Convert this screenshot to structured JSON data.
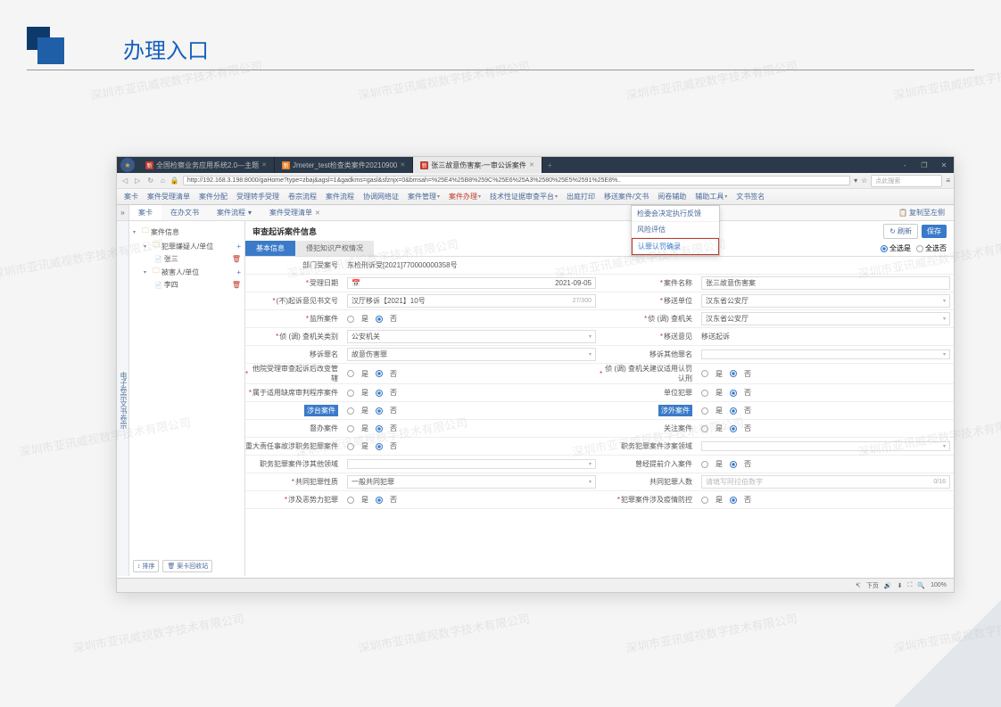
{
  "watermark_text": "深圳市亚讯威视数字技术有限公司",
  "slide": {
    "title": "办理入口"
  },
  "browser": {
    "tabs": [
      {
        "label": "全国检察业务应用系统2.0—主题",
        "badge": "新"
      },
      {
        "label": "Jmeter_test检查类案件20210900",
        "badge": "新"
      },
      {
        "label": "张三故意伤害案-一审公诉案件",
        "badge": "新",
        "active": true
      }
    ],
    "url": "http://192.168.3.198:8000/gaHome?type=zbaj&agsl=1&gadkms=gasl&sfznjx=0&bmsah=%25E4%25B8%259C%25E6%25A3%2580%25E5%2591%25E8%..",
    "search_placeholder": "点此搜索"
  },
  "menu": {
    "items": [
      "案卡",
      "案件受理清单",
      "案件分配",
      "受理转手受理",
      "卷宗流程",
      "案件流程",
      "协调网络证",
      "案件管理",
      "案件办理",
      "技术性证据审查平台",
      "出庭打印",
      "移送案件/文书",
      "阅卷辅助",
      "辅助工具",
      "文书签名"
    ]
  },
  "dropdown": {
    "items": [
      "检委会决定执行反馈",
      "风险评估",
      "认罪认罚确录"
    ]
  },
  "sub_tabs": {
    "items": [
      "案卡",
      "在办文书",
      "案件流程",
      "案件受理清单"
    ],
    "right_link": "复制至左侧"
  },
  "side_strip": "电子卷宗文书卷宗",
  "tree": {
    "root": "案件信息",
    "nodes": [
      {
        "label": "犯罪嫌疑人/单位",
        "icon": "folder",
        "plus": true
      },
      {
        "label": "张三",
        "icon": "doc",
        "indent": 2
      },
      {
        "label": "被害人/单位",
        "icon": "folder",
        "plus": true
      },
      {
        "label": "李四",
        "icon": "doc",
        "indent": 2
      }
    ],
    "footer": [
      "排序",
      "案卡回收站"
    ]
  },
  "form": {
    "title": "审查起诉案件信息",
    "actions": {
      "refresh": "刷新",
      "save": "保存"
    },
    "inner_tabs": [
      "基本信息",
      "侵犯知识产权情况"
    ],
    "top_opts": [
      "全选是",
      "全选否"
    ],
    "fields": {
      "dept_no_label": "部门受案号",
      "dept_no": "东检刑诉受[2021]770000000358号",
      "accept_date_label": "受理日期",
      "accept_date": "2021-09-05",
      "case_name_label": "案件名称",
      "case_name": "张三故意伤害案",
      "doc_no_label": "(不)起诉意见书文号",
      "doc_no": "汉厅移诉【2021】10号",
      "doc_no_counter": "27/300",
      "transfer_unit_label": "移送单位",
      "transfer_unit": "汉东省公安厅",
      "supervise_label": "监所案件",
      "investigate_org_label": "侦 (调) 查机关",
      "investigate_org": "汉东省公安厅",
      "org_type_label": "侦 (调) 查机关类别",
      "org_type": "公安机关",
      "transfer_opinion_label": "移送意见",
      "transfer_opinion": "移送起诉",
      "crime_name_label": "移诉罪名",
      "crime_name": "故意伤害罪",
      "other_crime_label": "移诉其他罪名",
      "court_change_label": "他院受理审查起诉后改变管辖",
      "suggest_plea_label": "侦 (调) 查机关建议适用认罚认刑",
      "proc_violation_label": "属于适用缺席审判程序案件",
      "unit_crime_label": "单位犯罪",
      "taiwan_label": "涉台案件",
      "foreign_label": "涉外案件",
      "supervise2_label": "督办案件",
      "focus_label": "关注案件",
      "major_liab_label": "重大责任事故涉职务犯罪案件",
      "duty_crime_area_label": "职务犯罪案件涉案领域",
      "duty_crime_other_label": "职务犯罪案件涉其他领域",
      "supervisor_intervene_label": "曾经提前介入案件",
      "crime_nature_label": "共同犯罪性质",
      "crime_nature": "一般共同犯罪",
      "codefendant_count_label": "共同犯罪人数",
      "codefendant_placeholder": "请填写阿拉伯数字",
      "codefendant_counter": "0/16",
      "violence_label": "涉及恶势力犯罪",
      "epidemic_label": "犯罪案件涉及疫情防控"
    },
    "radio": {
      "yes": "是",
      "no": "否"
    }
  },
  "status_bar": {
    "nav": "下页",
    "zoom": "100%"
  }
}
